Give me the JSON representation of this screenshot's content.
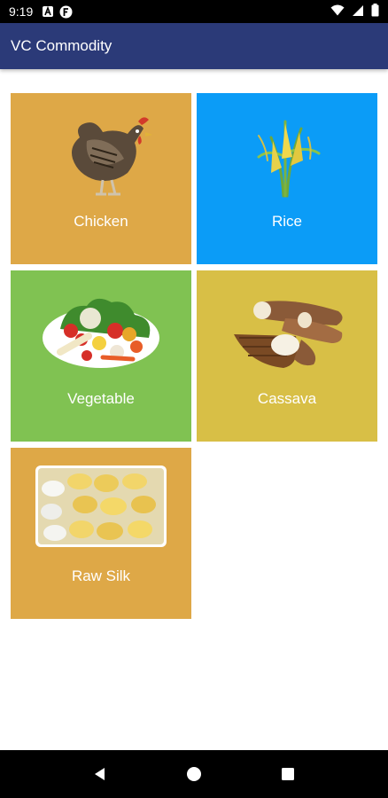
{
  "status_bar": {
    "time": "9:19",
    "icons": [
      "notification-a-icon",
      "notification-f-icon",
      "wifi-icon",
      "signal-icon",
      "battery-icon"
    ]
  },
  "app_bar": {
    "title": "VC Commodity",
    "color": "#2b3a78"
  },
  "commodities": [
    {
      "label": "Chicken",
      "color": "#dea847",
      "icon": "chicken-icon"
    },
    {
      "label": "Rice",
      "color": "#0b9cf7",
      "icon": "rice-icon"
    },
    {
      "label": "Vegetable",
      "color": "#80c252",
      "icon": "vegetable-icon"
    },
    {
      "label": "Cassava",
      "color": "#d8bf46",
      "icon": "cassava-icon"
    },
    {
      "label": "Raw Silk",
      "color": "#dea847",
      "icon": "raw-silk-icon"
    }
  ],
  "nav_bar": {
    "icons": [
      "back-icon",
      "home-icon",
      "recents-icon"
    ]
  }
}
